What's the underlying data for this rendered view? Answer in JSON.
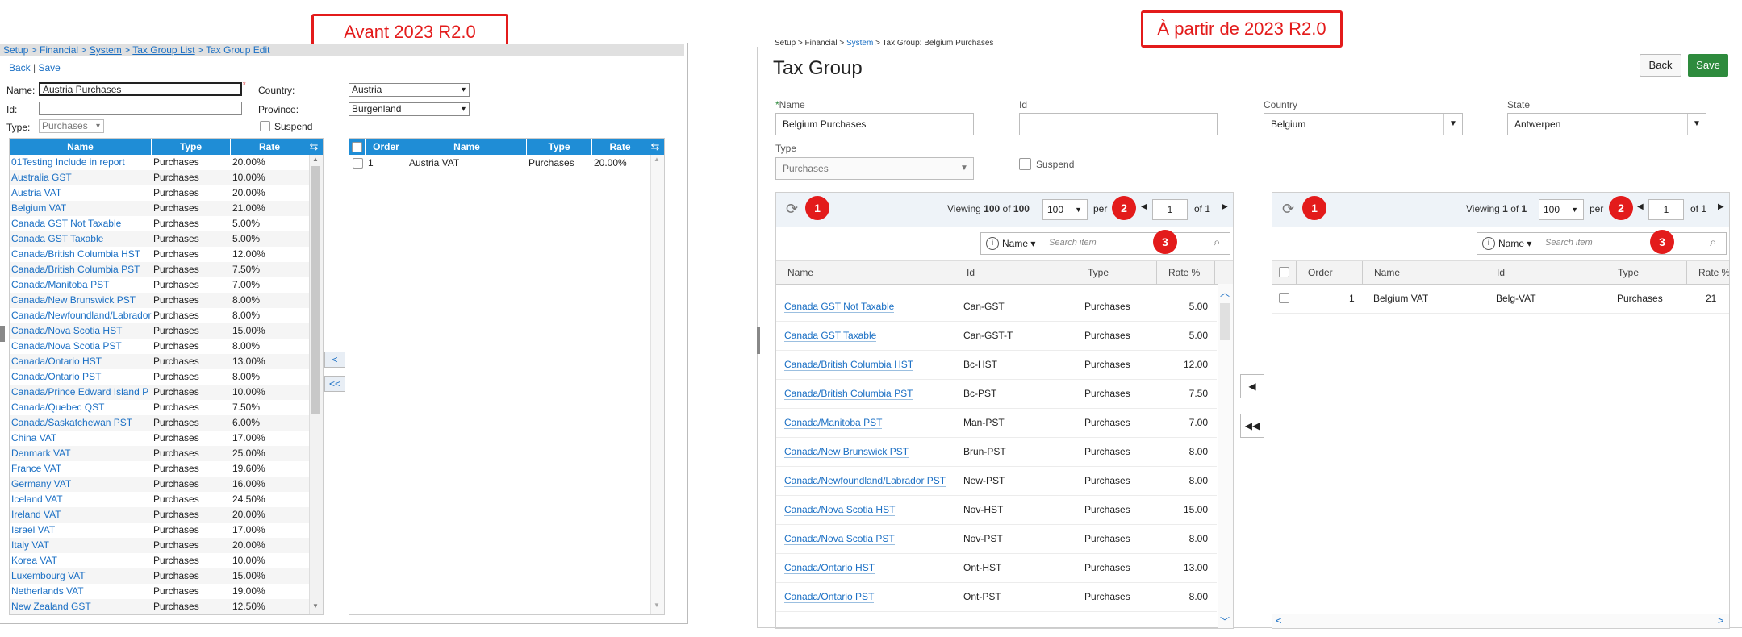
{
  "labels": {
    "before": "Avant 2023 R2.0",
    "after": "À partir de 2023 R2.0"
  },
  "old": {
    "breadcrumb": [
      "Setup",
      "Financial",
      "System",
      "Tax Group List",
      "Tax Group Edit"
    ],
    "actions": {
      "back": "Back",
      "save": "Save"
    },
    "form": {
      "name_label": "Name:",
      "name_value": "Austria Purchases",
      "id_label": "Id:",
      "id_value": "",
      "type_label": "Type:",
      "type_value": "Purchases",
      "country_label": "Country:",
      "country_value": "Austria",
      "province_label": "Province:",
      "province_value": "Burgenland",
      "suspend_label": "Suspend"
    },
    "left_table": {
      "headers": [
        "Name",
        "Type",
        "Rate"
      ],
      "rows": [
        [
          "01Testing Include in report",
          "Purchases",
          "20.00%"
        ],
        [
          "Australia GST",
          "Purchases",
          "10.00%"
        ],
        [
          "Austria VAT",
          "Purchases",
          "20.00%"
        ],
        [
          "Belgium VAT",
          "Purchases",
          "21.00%"
        ],
        [
          "Canada GST Not Taxable",
          "Purchases",
          "5.00%"
        ],
        [
          "Canada GST Taxable",
          "Purchases",
          "5.00%"
        ],
        [
          "Canada/British Columbia HST",
          "Purchases",
          "12.00%"
        ],
        [
          "Canada/British Columbia PST",
          "Purchases",
          "7.50%"
        ],
        [
          "Canada/Manitoba PST",
          "Purchases",
          "7.00%"
        ],
        [
          "Canada/New Brunswick PST",
          "Purchases",
          "8.00%"
        ],
        [
          "Canada/Newfoundland/Labrador",
          "Purchases",
          "8.00%"
        ],
        [
          "Canada/Nova Scotia HST",
          "Purchases",
          "15.00%"
        ],
        [
          "Canada/Nova Scotia PST",
          "Purchases",
          "8.00%"
        ],
        [
          "Canada/Ontario HST",
          "Purchases",
          "13.00%"
        ],
        [
          "Canada/Ontario PST",
          "Purchases",
          "8.00%"
        ],
        [
          "Canada/Prince Edward Island P",
          "Purchases",
          "10.00%"
        ],
        [
          "Canada/Quebec QST",
          "Purchases",
          "7.50%"
        ],
        [
          "Canada/Saskatchewan PST",
          "Purchases",
          "6.00%"
        ],
        [
          "China VAT",
          "Purchases",
          "17.00%"
        ],
        [
          "Denmark VAT",
          "Purchases",
          "25.00%"
        ],
        [
          "France VAT",
          "Purchases",
          "19.60%"
        ],
        [
          "Germany VAT",
          "Purchases",
          "16.00%"
        ],
        [
          "Iceland VAT",
          "Purchases",
          "24.50%"
        ],
        [
          "Ireland VAT",
          "Purchases",
          "20.00%"
        ],
        [
          "Israel VAT",
          "Purchases",
          "17.00%"
        ],
        [
          "Italy VAT",
          "Purchases",
          "20.00%"
        ],
        [
          "Korea VAT",
          "Purchases",
          "10.00%"
        ],
        [
          "Luxembourg VAT",
          "Purchases",
          "15.00%"
        ],
        [
          "Netherlands VAT",
          "Purchases",
          "19.00%"
        ],
        [
          "New Zealand GST",
          "Purchases",
          "12.50%"
        ]
      ]
    },
    "move_buttons": [
      "<",
      "<<"
    ],
    "right_table": {
      "headers": [
        "Order",
        "Name",
        "Type",
        "Rate"
      ],
      "rows": [
        [
          "1",
          "Austria VAT",
          "Purchases",
          "20.00%"
        ]
      ]
    }
  },
  "new": {
    "breadcrumb": [
      "Setup",
      "Financial",
      "System",
      "Tax Group: Belgium Purchases"
    ],
    "title": "Tax Group",
    "buttons": {
      "back": "Back",
      "save": "Save"
    },
    "form": {
      "name_label": "Name",
      "name_value": "Belgium Purchases",
      "id_label": "Id",
      "id_value": "",
      "country_label": "Country",
      "country_value": "Belgium",
      "state_label": "State",
      "state_value": "Antwerpen",
      "type_label": "Type",
      "type_value": "Purchases",
      "suspend_label": "Suspend"
    },
    "left_grid": {
      "viewing": "Viewing",
      "count": "100",
      "of": "of",
      "total": "100",
      "per_page": "100",
      "per": "per",
      "page": "1",
      "pages": "1",
      "search_field": "Name",
      "search_placeholder": "Search item",
      "headers": [
        "Name",
        "Id",
        "Type",
        "Rate %"
      ],
      "rows": [
        [
          "Canada GST Not Taxable",
          "Can-GST",
          "Purchases",
          "5.00"
        ],
        [
          "Canada GST Taxable",
          "Can-GST-T",
          "Purchases",
          "5.00"
        ],
        [
          "Canada/British Columbia HST",
          "Bc-HST",
          "Purchases",
          "12.00"
        ],
        [
          "Canada/British Columbia PST",
          "Bc-PST",
          "Purchases",
          "7.50"
        ],
        [
          "Canada/Manitoba PST",
          "Man-PST",
          "Purchases",
          "7.00"
        ],
        [
          "Canada/New Brunswick PST",
          "Brun-PST",
          "Purchases",
          "8.00"
        ],
        [
          "Canada/Newfoundland/Labrador PST",
          "New-PST",
          "Purchases",
          "8.00"
        ],
        [
          "Canada/Nova Scotia HST",
          "Nov-HST",
          "Purchases",
          "15.00"
        ],
        [
          "Canada/Nova Scotia PST",
          "Nov-PST",
          "Purchases",
          "8.00"
        ],
        [
          "Canada/Ontario HST",
          "Ont-HST",
          "Purchases",
          "13.00"
        ],
        [
          "Canada/Ontario PST",
          "Ont-PST",
          "Purchases",
          "8.00"
        ]
      ]
    },
    "right_grid": {
      "viewing": "Viewing",
      "count": "1",
      "of": "of",
      "total": "1",
      "per_page": "100",
      "per": "per",
      "page": "1",
      "pages": "1",
      "search_field": "Name",
      "search_placeholder": "Search item",
      "headers": [
        "Order",
        "Name",
        "Id",
        "Type",
        "Rate %"
      ],
      "rows": [
        [
          "1",
          "Belgium VAT",
          "Belg-VAT",
          "Purchases",
          "21"
        ]
      ]
    },
    "badges": [
      "1",
      "2",
      "3"
    ],
    "colors": {
      "accent": "#1f8dd6",
      "save": "#2e8b3d",
      "badge": "#e31b1b"
    }
  }
}
